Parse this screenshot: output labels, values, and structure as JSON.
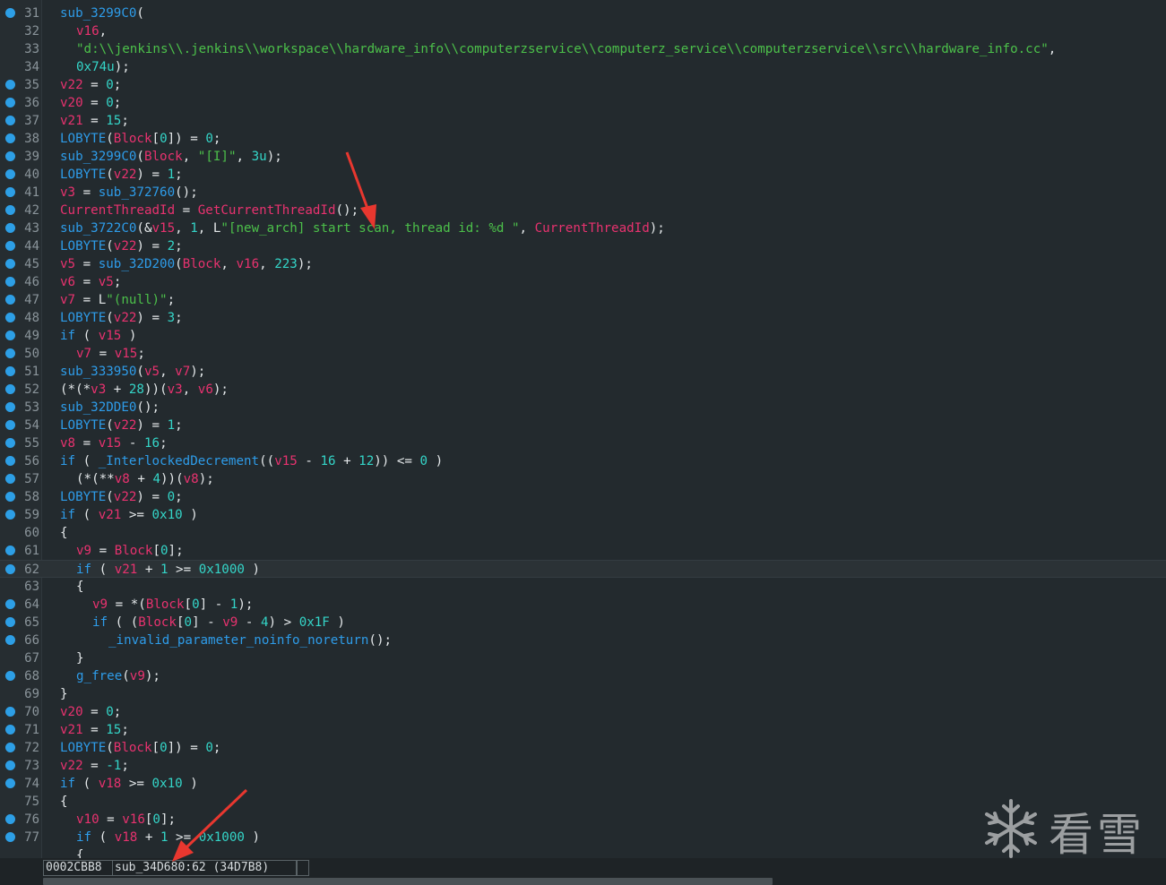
{
  "lines": [
    {
      "n": "31",
      "bp": true,
      "indent": 2,
      "tokens": [
        [
          "id",
          "sub_3299C0"
        ],
        [
          "ap",
          "("
        ]
      ]
    },
    {
      "n": "32",
      "bp": false,
      "indent": 4,
      "tokens": [
        [
          "lv",
          "v16"
        ],
        [
          "ap",
          ","
        ]
      ]
    },
    {
      "n": "33",
      "bp": false,
      "indent": 4,
      "tokens": [
        [
          "st",
          "\"d:\\\\jenkins\\\\.jenkins\\\\workspace\\\\hardware_info\\\\computerzservice\\\\computerz_service\\\\computerzservice\\\\src\\\\hardware_info.cc\""
        ],
        [
          "ap",
          ","
        ]
      ]
    },
    {
      "n": "34",
      "bp": false,
      "indent": 4,
      "tokens": [
        [
          "nm",
          "0x74u"
        ],
        [
          "ap",
          ");"
        ]
      ]
    },
    {
      "n": "35",
      "bp": true,
      "indent": 2,
      "tokens": [
        [
          "lv",
          "v22"
        ],
        [
          "ap",
          " = "
        ],
        [
          "nm",
          "0"
        ],
        [
          "ap",
          ";"
        ]
      ]
    },
    {
      "n": "36",
      "bp": true,
      "indent": 2,
      "tokens": [
        [
          "lv",
          "v20"
        ],
        [
          "ap",
          " = "
        ],
        [
          "nm",
          "0"
        ],
        [
          "ap",
          ";"
        ]
      ]
    },
    {
      "n": "37",
      "bp": true,
      "indent": 2,
      "tokens": [
        [
          "lv",
          "v21"
        ],
        [
          "ap",
          " = "
        ],
        [
          "nm",
          "15"
        ],
        [
          "ap",
          ";"
        ]
      ]
    },
    {
      "n": "38",
      "bp": true,
      "indent": 2,
      "tokens": [
        [
          "id",
          "LOBYTE"
        ],
        [
          "ap",
          "("
        ],
        [
          "lv",
          "Block"
        ],
        [
          "ap",
          "["
        ],
        [
          "nm",
          "0"
        ],
        [
          "ap",
          "]) = "
        ],
        [
          "nm",
          "0"
        ],
        [
          "ap",
          ";"
        ]
      ]
    },
    {
      "n": "39",
      "bp": true,
      "indent": 2,
      "tokens": [
        [
          "id",
          "sub_3299C0"
        ],
        [
          "ap",
          "("
        ],
        [
          "lv",
          "Block"
        ],
        [
          "ap",
          ", "
        ],
        [
          "st",
          "\"[I]\""
        ],
        [
          "ap",
          ", "
        ],
        [
          "nm",
          "3u"
        ],
        [
          "ap",
          ");"
        ]
      ]
    },
    {
      "n": "40",
      "bp": true,
      "indent": 2,
      "tokens": [
        [
          "id",
          "LOBYTE"
        ],
        [
          "ap",
          "("
        ],
        [
          "lv",
          "v22"
        ],
        [
          "ap",
          ") = "
        ],
        [
          "nm",
          "1"
        ],
        [
          "ap",
          ";"
        ]
      ]
    },
    {
      "n": "41",
      "bp": true,
      "indent": 2,
      "tokens": [
        [
          "lv",
          "v3"
        ],
        [
          "ap",
          " = "
        ],
        [
          "id",
          "sub_372760"
        ],
        [
          "ap",
          "();"
        ]
      ]
    },
    {
      "n": "42",
      "bp": true,
      "indent": 2,
      "tokens": [
        [
          "fn",
          "CurrentThreadId"
        ],
        [
          "ap",
          " = "
        ],
        [
          "fn",
          "GetCurrentThreadId"
        ],
        [
          "ap",
          "();"
        ]
      ]
    },
    {
      "n": "43",
      "bp": true,
      "indent": 2,
      "tokens": [
        [
          "id",
          "sub_3722C0"
        ],
        [
          "ap",
          "(&"
        ],
        [
          "lv",
          "v15"
        ],
        [
          "ap",
          ", "
        ],
        [
          "nm",
          "1"
        ],
        [
          "ap",
          ", L"
        ],
        [
          "st",
          "\"[new_arch] start scan, thread id: %d \""
        ],
        [
          "ap",
          ", "
        ],
        [
          "fn",
          "CurrentThreadId"
        ],
        [
          "ap",
          ");"
        ]
      ]
    },
    {
      "n": "44",
      "bp": true,
      "indent": 2,
      "tokens": [
        [
          "id",
          "LOBYTE"
        ],
        [
          "ap",
          "("
        ],
        [
          "lv",
          "v22"
        ],
        [
          "ap",
          ") = "
        ],
        [
          "nm",
          "2"
        ],
        [
          "ap",
          ";"
        ]
      ]
    },
    {
      "n": "45",
      "bp": true,
      "indent": 2,
      "tokens": [
        [
          "lv",
          "v5"
        ],
        [
          "ap",
          " = "
        ],
        [
          "id",
          "sub_32D200"
        ],
        [
          "ap",
          "("
        ],
        [
          "lv",
          "Block"
        ],
        [
          "ap",
          ", "
        ],
        [
          "lv",
          "v16"
        ],
        [
          "ap",
          ", "
        ],
        [
          "nm",
          "223"
        ],
        [
          "ap",
          ");"
        ]
      ]
    },
    {
      "n": "46",
      "bp": true,
      "indent": 2,
      "tokens": [
        [
          "lv",
          "v6"
        ],
        [
          "ap",
          " = "
        ],
        [
          "lv",
          "v5"
        ],
        [
          "ap",
          ";"
        ]
      ]
    },
    {
      "n": "47",
      "bp": true,
      "indent": 2,
      "tokens": [
        [
          "lv",
          "v7"
        ],
        [
          "ap",
          " = L"
        ],
        [
          "st",
          "\"(null)\""
        ],
        [
          "ap",
          ";"
        ]
      ]
    },
    {
      "n": "48",
      "bp": true,
      "indent": 2,
      "tokens": [
        [
          "id",
          "LOBYTE"
        ],
        [
          "ap",
          "("
        ],
        [
          "lv",
          "v22"
        ],
        [
          "ap",
          ") = "
        ],
        [
          "nm",
          "3"
        ],
        [
          "ap",
          ";"
        ]
      ]
    },
    {
      "n": "49",
      "bp": true,
      "indent": 2,
      "tokens": [
        [
          "id",
          "if"
        ],
        [
          "ap",
          " ( "
        ],
        [
          "lv",
          "v15"
        ],
        [
          "ap",
          " )"
        ]
      ]
    },
    {
      "n": "50",
      "bp": true,
      "indent": 4,
      "tokens": [
        [
          "lv",
          "v7"
        ],
        [
          "ap",
          " = "
        ],
        [
          "lv",
          "v15"
        ],
        [
          "ap",
          ";"
        ]
      ]
    },
    {
      "n": "51",
      "bp": true,
      "indent": 2,
      "tokens": [
        [
          "id",
          "sub_333950"
        ],
        [
          "ap",
          "("
        ],
        [
          "lv",
          "v5"
        ],
        [
          "ap",
          ", "
        ],
        [
          "lv",
          "v7"
        ],
        [
          "ap",
          ");"
        ]
      ]
    },
    {
      "n": "52",
      "bp": true,
      "indent": 2,
      "tokens": [
        [
          "ap",
          "(*(*"
        ],
        [
          "lv",
          "v3"
        ],
        [
          "ap",
          " + "
        ],
        [
          "nm",
          "28"
        ],
        [
          "ap",
          "))("
        ],
        [
          "lv",
          "v3"
        ],
        [
          "ap",
          ", "
        ],
        [
          "lv",
          "v6"
        ],
        [
          "ap",
          ");"
        ]
      ]
    },
    {
      "n": "53",
      "bp": true,
      "indent": 2,
      "tokens": [
        [
          "id",
          "sub_32DDE0"
        ],
        [
          "ap",
          "();"
        ]
      ]
    },
    {
      "n": "54",
      "bp": true,
      "indent": 2,
      "tokens": [
        [
          "id",
          "LOBYTE"
        ],
        [
          "ap",
          "("
        ],
        [
          "lv",
          "v22"
        ],
        [
          "ap",
          ") = "
        ],
        [
          "nm",
          "1"
        ],
        [
          "ap",
          ";"
        ]
      ]
    },
    {
      "n": "55",
      "bp": true,
      "indent": 2,
      "tokens": [
        [
          "lv",
          "v8"
        ],
        [
          "ap",
          " = "
        ],
        [
          "lv",
          "v15"
        ],
        [
          "ap",
          " - "
        ],
        [
          "nm",
          "16"
        ],
        [
          "ap",
          ";"
        ]
      ]
    },
    {
      "n": "56",
      "bp": true,
      "indent": 2,
      "tokens": [
        [
          "id",
          "if"
        ],
        [
          "ap",
          " ( "
        ],
        [
          "id",
          "_InterlockedDecrement"
        ],
        [
          "ap",
          "(("
        ],
        [
          "lv",
          "v15"
        ],
        [
          "ap",
          " - "
        ],
        [
          "nm",
          "16"
        ],
        [
          "ap",
          " + "
        ],
        [
          "nm",
          "12"
        ],
        [
          "ap",
          ")) <= "
        ],
        [
          "nm",
          "0"
        ],
        [
          "ap",
          " )"
        ]
      ]
    },
    {
      "n": "57",
      "bp": true,
      "indent": 4,
      "tokens": [
        [
          "ap",
          "(*(**"
        ],
        [
          "lv",
          "v8"
        ],
        [
          "ap",
          " + "
        ],
        [
          "nm",
          "4"
        ],
        [
          "ap",
          "))("
        ],
        [
          "lv",
          "v8"
        ],
        [
          "ap",
          ");"
        ]
      ]
    },
    {
      "n": "58",
      "bp": true,
      "indent": 2,
      "tokens": [
        [
          "id",
          "LOBYTE"
        ],
        [
          "ap",
          "("
        ],
        [
          "lv",
          "v22"
        ],
        [
          "ap",
          ") = "
        ],
        [
          "nm",
          "0"
        ],
        [
          "ap",
          ";"
        ]
      ]
    },
    {
      "n": "59",
      "bp": true,
      "indent": 2,
      "tokens": [
        [
          "id",
          "if"
        ],
        [
          "ap",
          " ( "
        ],
        [
          "lv",
          "v21"
        ],
        [
          "ap",
          " >= "
        ],
        [
          "nm",
          "0x10"
        ],
        [
          "ap",
          " )"
        ]
      ]
    },
    {
      "n": "60",
      "bp": false,
      "indent": 2,
      "tokens": [
        [
          "ap",
          "{"
        ]
      ]
    },
    {
      "n": "61",
      "bp": true,
      "indent": 4,
      "tokens": [
        [
          "lv",
          "v9"
        ],
        [
          "ap",
          " = "
        ],
        [
          "lv",
          "Block"
        ],
        [
          "ap",
          "["
        ],
        [
          "nm",
          "0"
        ],
        [
          "ap",
          "];"
        ]
      ]
    },
    {
      "n": "62",
      "bp": true,
      "indent": 4,
      "current": true,
      "tokens": [
        [
          "id",
          "if"
        ],
        [
          "ap",
          " ( "
        ],
        [
          "lv",
          "v21"
        ],
        [
          "ap",
          " + "
        ],
        [
          "nm",
          "1"
        ],
        [
          "ap",
          " >= "
        ],
        [
          "nm",
          "0x1000"
        ],
        [
          "ap",
          " )"
        ]
      ]
    },
    {
      "n": "63",
      "bp": false,
      "indent": 4,
      "tokens": [
        [
          "ap",
          "{"
        ]
      ]
    },
    {
      "n": "64",
      "bp": true,
      "indent": 6,
      "tokens": [
        [
          "lv",
          "v9"
        ],
        [
          "ap",
          " = *("
        ],
        [
          "lv",
          "Block"
        ],
        [
          "ap",
          "["
        ],
        [
          "nm",
          "0"
        ],
        [
          "ap",
          "] - "
        ],
        [
          "nm",
          "1"
        ],
        [
          "ap",
          ");"
        ]
      ]
    },
    {
      "n": "65",
      "bp": true,
      "indent": 6,
      "tokens": [
        [
          "id",
          "if"
        ],
        [
          "ap",
          " ( ("
        ],
        [
          "lv",
          "Block"
        ],
        [
          "ap",
          "["
        ],
        [
          "nm",
          "0"
        ],
        [
          "ap",
          "] - "
        ],
        [
          "lv",
          "v9"
        ],
        [
          "ap",
          " - "
        ],
        [
          "nm",
          "4"
        ],
        [
          "ap",
          ") > "
        ],
        [
          "nm",
          "0x1F"
        ],
        [
          "ap",
          " )"
        ]
      ]
    },
    {
      "n": "66",
      "bp": true,
      "indent": 8,
      "tokens": [
        [
          "id",
          "_invalid_parameter_noinfo_noreturn"
        ],
        [
          "ap",
          "();"
        ]
      ]
    },
    {
      "n": "67",
      "bp": false,
      "indent": 4,
      "tokens": [
        [
          "ap",
          "}"
        ]
      ]
    },
    {
      "n": "68",
      "bp": true,
      "indent": 4,
      "tokens": [
        [
          "id",
          "g_free"
        ],
        [
          "ap",
          "("
        ],
        [
          "lv",
          "v9"
        ],
        [
          "ap",
          ");"
        ]
      ]
    },
    {
      "n": "69",
      "bp": false,
      "indent": 2,
      "tokens": [
        [
          "ap",
          "}"
        ]
      ]
    },
    {
      "n": "70",
      "bp": true,
      "indent": 2,
      "tokens": [
        [
          "lv",
          "v20"
        ],
        [
          "ap",
          " = "
        ],
        [
          "nm",
          "0"
        ],
        [
          "ap",
          ";"
        ]
      ]
    },
    {
      "n": "71",
      "bp": true,
      "indent": 2,
      "tokens": [
        [
          "lv",
          "v21"
        ],
        [
          "ap",
          " = "
        ],
        [
          "nm",
          "15"
        ],
        [
          "ap",
          ";"
        ]
      ]
    },
    {
      "n": "72",
      "bp": true,
      "indent": 2,
      "tokens": [
        [
          "id",
          "LOBYTE"
        ],
        [
          "ap",
          "("
        ],
        [
          "lv",
          "Block"
        ],
        [
          "ap",
          "["
        ],
        [
          "nm",
          "0"
        ],
        [
          "ap",
          "]) = "
        ],
        [
          "nm",
          "0"
        ],
        [
          "ap",
          ";"
        ]
      ]
    },
    {
      "n": "73",
      "bp": true,
      "indent": 2,
      "tokens": [
        [
          "lv",
          "v22"
        ],
        [
          "ap",
          " = "
        ],
        [
          "nm",
          "-1"
        ],
        [
          "ap",
          ";"
        ]
      ]
    },
    {
      "n": "74",
      "bp": true,
      "indent": 2,
      "tokens": [
        [
          "id",
          "if"
        ],
        [
          "ap",
          " ( "
        ],
        [
          "lv",
          "v18"
        ],
        [
          "ap",
          " >= "
        ],
        [
          "nm",
          "0x10"
        ],
        [
          "ap",
          " )"
        ]
      ]
    },
    {
      "n": "75",
      "bp": false,
      "indent": 2,
      "tokens": [
        [
          "ap",
          "{"
        ]
      ]
    },
    {
      "n": "76",
      "bp": true,
      "indent": 4,
      "tokens": [
        [
          "lv",
          "v10"
        ],
        [
          "ap",
          " = "
        ],
        [
          "lv",
          "v16"
        ],
        [
          "ap",
          "["
        ],
        [
          "nm",
          "0"
        ],
        [
          "ap",
          "];"
        ]
      ]
    },
    {
      "n": "77",
      "bp": true,
      "indent": 4,
      "tokens": [
        [
          "id",
          "if"
        ],
        [
          "ap",
          " ( "
        ],
        [
          "lv",
          "v18"
        ],
        [
          "ap",
          " + "
        ],
        [
          "nm",
          "1"
        ],
        [
          "ap",
          " >= "
        ],
        [
          "nm",
          "0x1000"
        ],
        [
          "ap",
          " )"
        ]
      ]
    },
    {
      "n": "",
      "bp": false,
      "indent": 4,
      "tokens": [
        [
          "ap",
          "{"
        ]
      ]
    }
  ],
  "status": {
    "address": "0002CBB8",
    "location": "sub_34D680:62 (34D7B8)"
  },
  "watermark": {
    "text": "看雪",
    "icon": "snowflake-icon"
  },
  "colors": {
    "identifier": "#2e9ce9",
    "local_var": "#e8326f",
    "number": "#34d5c8",
    "string": "#4cc04a",
    "arrow": "#e8372f"
  }
}
